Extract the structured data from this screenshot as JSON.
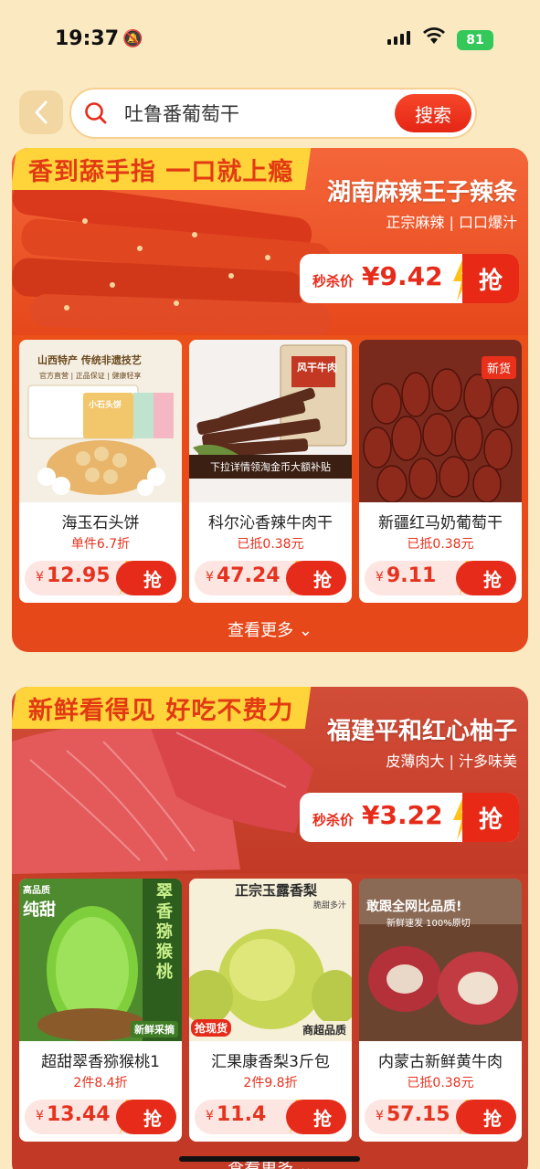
{
  "status_bar": {
    "time": "19:37",
    "battery": "81"
  },
  "search": {
    "value": "吐鲁番葡萄干",
    "button": "搜索"
  },
  "sections": [
    {
      "banner": "香到舔手指 一口就上瘾",
      "hero": {
        "title": "湖南麻辣王子辣条",
        "subtitle": "正宗麻辣 | 口口爆汁",
        "price_label": "秒杀价",
        "price": "¥9.42",
        "grab": "抢"
      },
      "products": [
        {
          "name": "海玉石头饼",
          "sub": "单件6.7折",
          "cur": "¥",
          "price": "12.95",
          "grab": "抢",
          "img_lines": [
            "山西特产 传统非遗技艺",
            "官方直营 | 正品保证 | 健康轻享",
            "小石头饼"
          ]
        },
        {
          "name": "科尔沁香辣牛肉干",
          "sub": "已抵0.38元",
          "cur": "¥",
          "price": "47.24",
          "grab": "抢",
          "img_lines": [
            "风干牛肉",
            "下拉详情领淘金币大额补贴"
          ]
        },
        {
          "name": "新疆红马奶葡萄干",
          "sub": "已抵0.38元",
          "cur": "¥",
          "price": "9.11",
          "grab": "抢",
          "img_lines": [
            "新货"
          ]
        }
      ],
      "more": "查看更多"
    },
    {
      "banner": "新鲜看得见 好吃不费力",
      "hero": {
        "title": "福建平和红心柚子",
        "subtitle": "皮薄肉大 | 汁多味美",
        "price_label": "秒杀价",
        "price": "¥3.22",
        "grab": "抢"
      },
      "products": [
        {
          "name": "超甜翠香猕猴桃1",
          "sub": "2件8.4折",
          "cur": "¥",
          "price": "13.44",
          "grab": "抢",
          "img_lines": [
            "高品质",
            "纯甜",
            "翠香猕猴桃",
            "新鲜采摘"
          ]
        },
        {
          "name": "汇果康香梨3斤包",
          "sub": "2件9.8折",
          "cur": "¥",
          "price": "11.4",
          "grab": "抢",
          "img_lines": [
            "正宗玉露香梨",
            "脆甜多汁",
            "抢现货",
            "商超品质"
          ]
        },
        {
          "name": "内蒙古新鲜黄牛肉",
          "sub": "已抵0.38元",
          "cur": "¥",
          "price": "57.15",
          "grab": "抢",
          "img_lines": [
            "敢跟全网比品质!",
            "新鲜速发 100%原切"
          ]
        }
      ],
      "more": "查看更多"
    }
  ],
  "colors": {
    "accent": "#e72b1a",
    "banner_yellow": "#ffd43b",
    "page_bg": "#fbe9c2"
  }
}
